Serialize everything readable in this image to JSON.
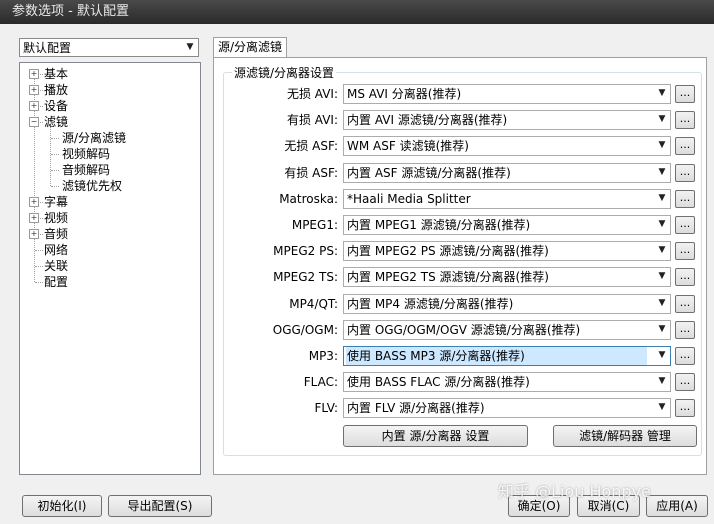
{
  "window": {
    "title": "参数选项 - 默认配置"
  },
  "profile": {
    "selected": "默认配置"
  },
  "tree": {
    "items": [
      {
        "label": "基本",
        "expander": "+"
      },
      {
        "label": "播放",
        "expander": "+"
      },
      {
        "label": "设备",
        "expander": "+"
      },
      {
        "label": "滤镜",
        "expander": "-"
      },
      {
        "label": "源/分离滤镜",
        "selected": true
      },
      {
        "label": "视频解码"
      },
      {
        "label": "音频解码"
      },
      {
        "label": "滤镜优先权"
      },
      {
        "label": "字幕",
        "expander": "+"
      },
      {
        "label": "视频",
        "expander": "+"
      },
      {
        "label": "音频",
        "expander": "+"
      },
      {
        "label": "网络"
      },
      {
        "label": "关联"
      },
      {
        "label": "配置"
      }
    ]
  },
  "tab": {
    "label": "源/分离滤镜"
  },
  "group": {
    "title": "源滤镜/分离器设置"
  },
  "rows": [
    {
      "label": "无损 AVI:",
      "value": "MS AVI 分离器(推荐)"
    },
    {
      "label": "有损 AVI:",
      "value": "内置 AVI 源滤镜/分离器(推荐)"
    },
    {
      "label": "无损 ASF:",
      "value": "WM ASF 读滤镜(推荐)"
    },
    {
      "label": "有损 ASF:",
      "value": "内置 ASF 源滤镜/分离器(推荐)"
    },
    {
      "label": "Matroska:",
      "value": "*Haali Media Splitter"
    },
    {
      "label": "MPEG1:",
      "value": "内置 MPEG1 源滤镜/分离器(推荐)"
    },
    {
      "label": "MPEG2 PS:",
      "value": "内置 MPEG2 PS 源滤镜/分离器(推荐)"
    },
    {
      "label": "MPEG2 TS:",
      "value": "内置 MPEG2 TS 源滤镜/分离器(推荐)"
    },
    {
      "label": "MP4/QT:",
      "value": "内置 MP4 源滤镜/分离器(推荐)"
    },
    {
      "label": "OGG/OGM:",
      "value": "内置 OGG/OGM/OGV 源滤镜/分离器(推荐)"
    },
    {
      "label": "MP3:",
      "value": "使用 BASS MP3 源/分离器(推荐)",
      "selected": true
    },
    {
      "label": "FLAC:",
      "value": "使用 BASS FLAC 源/分离器(推荐)"
    },
    {
      "label": "FLV:",
      "value": "内置 FLV 源/分离器(推荐)"
    }
  ],
  "browse_label": "...",
  "buttons": {
    "builtin_settings": "内置 源/分离器 设置",
    "filter_manager": "滤镜/解码器 管理",
    "reset": "初始化(I)",
    "export": "导出配置(S)",
    "ok": "确定(O)",
    "cancel": "取消(C)",
    "apply": "应用(A)"
  },
  "watermark": "知乎 @Liou Honpye"
}
